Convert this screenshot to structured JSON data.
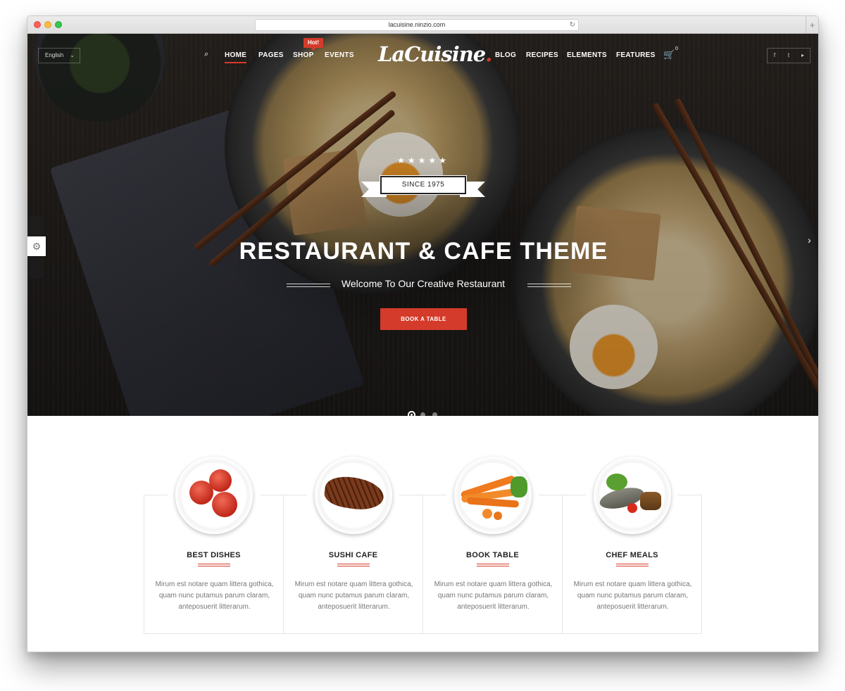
{
  "browser": {
    "url": "lacuisine.ninzio.com",
    "reload_icon": "↻",
    "newtab_icon": "+"
  },
  "header": {
    "language": "English",
    "language_chevron": "⌄",
    "search_icon": "⌕",
    "nav_left": [
      {
        "label": "HOME",
        "active": true
      },
      {
        "label": "PAGES",
        "active": false
      },
      {
        "label": "SHOP",
        "active": false
      },
      {
        "label": "EVENTS",
        "active": false
      }
    ],
    "hot_badge": "Hot!",
    "logo": "LaCuisine",
    "logo_dot": ".",
    "nav_right": [
      {
        "label": "BLOG"
      },
      {
        "label": "RECIPES"
      },
      {
        "label": "ELEMENTS"
      },
      {
        "label": "FEATURES"
      }
    ],
    "cart_icon": "🛒",
    "cart_count": "0",
    "socials": [
      "f",
      "t",
      "▸"
    ]
  },
  "hero": {
    "stars": "★★★★★",
    "ribbon": "SINCE 1975",
    "title": "RESTAURANT & CAFE THEME",
    "subtitle": "Welcome To Our Creative Restaurant",
    "button": "BOOK A TABLE",
    "slides": 3,
    "active_slide": 1,
    "next_arrow": "›",
    "gear_icon": "⚙"
  },
  "features": [
    {
      "title": "BEST DISHES",
      "text": "Mirum est notare quam littera gothica, quam nunc putamus parum claram, anteposuerit litterarum.",
      "food": "tomatoes"
    },
    {
      "title": "SUSHI CAFE",
      "text": "Mirum est notare quam littera gothica, quam nunc putamus parum claram, anteposuerit litterarum.",
      "food": "steak"
    },
    {
      "title": "BOOK TABLE",
      "text": "Mirum est notare quam littera gothica, quam nunc putamus parum claram, anteposuerit litterarum.",
      "food": "carrots"
    },
    {
      "title": "CHEF MEALS",
      "text": "Mirum est notare quam littera gothica, quam nunc putamus parum claram, anteposuerit litterarum.",
      "food": "fish"
    }
  ],
  "colors": {
    "accent": "#d43b2a"
  }
}
